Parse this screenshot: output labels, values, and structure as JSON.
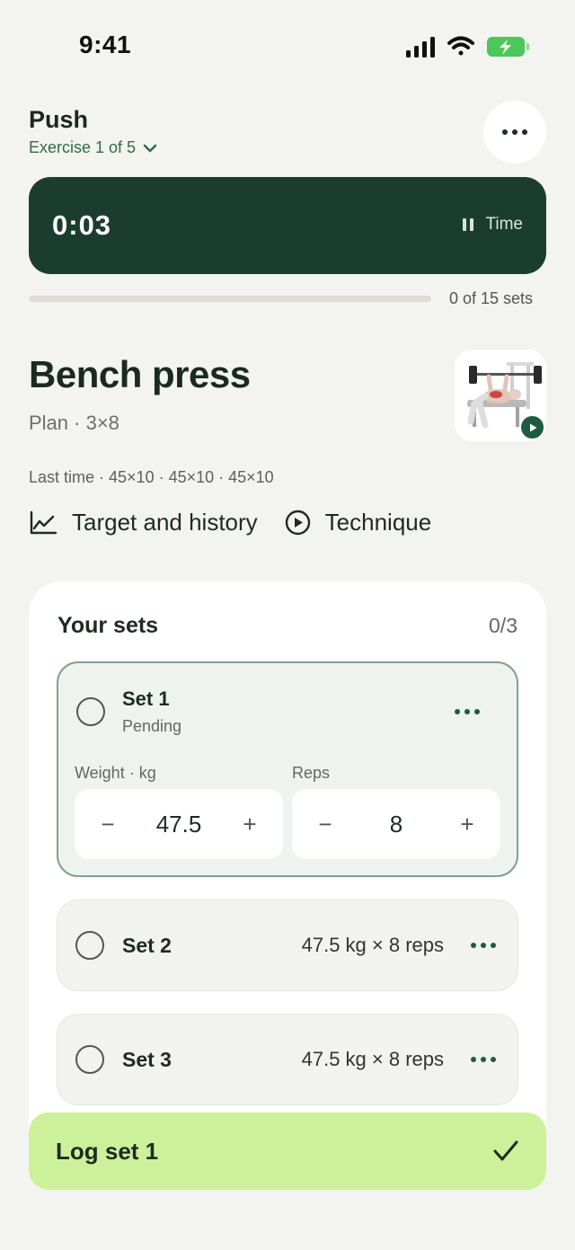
{
  "status_bar": {
    "time": "9:41"
  },
  "header": {
    "workout_title": "Push",
    "exercise_counter": "Exercise 1 of 5"
  },
  "timer": {
    "value": "0:03",
    "toggle_label": "Time"
  },
  "progress": {
    "label": "0 of 15 sets",
    "fraction": 0.0
  },
  "exercise": {
    "name": "Bench press",
    "plan": "Plan · 3×8",
    "last_time": "Last time · 45×10 · 45×10 · 45×10",
    "links": {
      "history_label": "Target and history",
      "technique_label": "Technique"
    }
  },
  "sets": {
    "heading": "Your sets",
    "count": "0/3",
    "active": {
      "title": "Set 1",
      "status": "Pending",
      "weight_label": "Weight · kg",
      "weight_value": "47.5",
      "reps_label": "Reps",
      "reps_value": "8",
      "minus": "−",
      "plus": "+"
    },
    "rows": [
      {
        "title": "Set 2",
        "summary": "47.5 kg × 8 reps"
      },
      {
        "title": "Set 3",
        "summary": "47.5 kg × 8 reps"
      }
    ]
  },
  "log_button": {
    "label": "Log set 1"
  },
  "colors": {
    "background": "#f3f3ef",
    "timer_bg": "#1b3d2f",
    "accent_green": "#2f6b4e",
    "log_button_bg": "#cdf19a"
  }
}
